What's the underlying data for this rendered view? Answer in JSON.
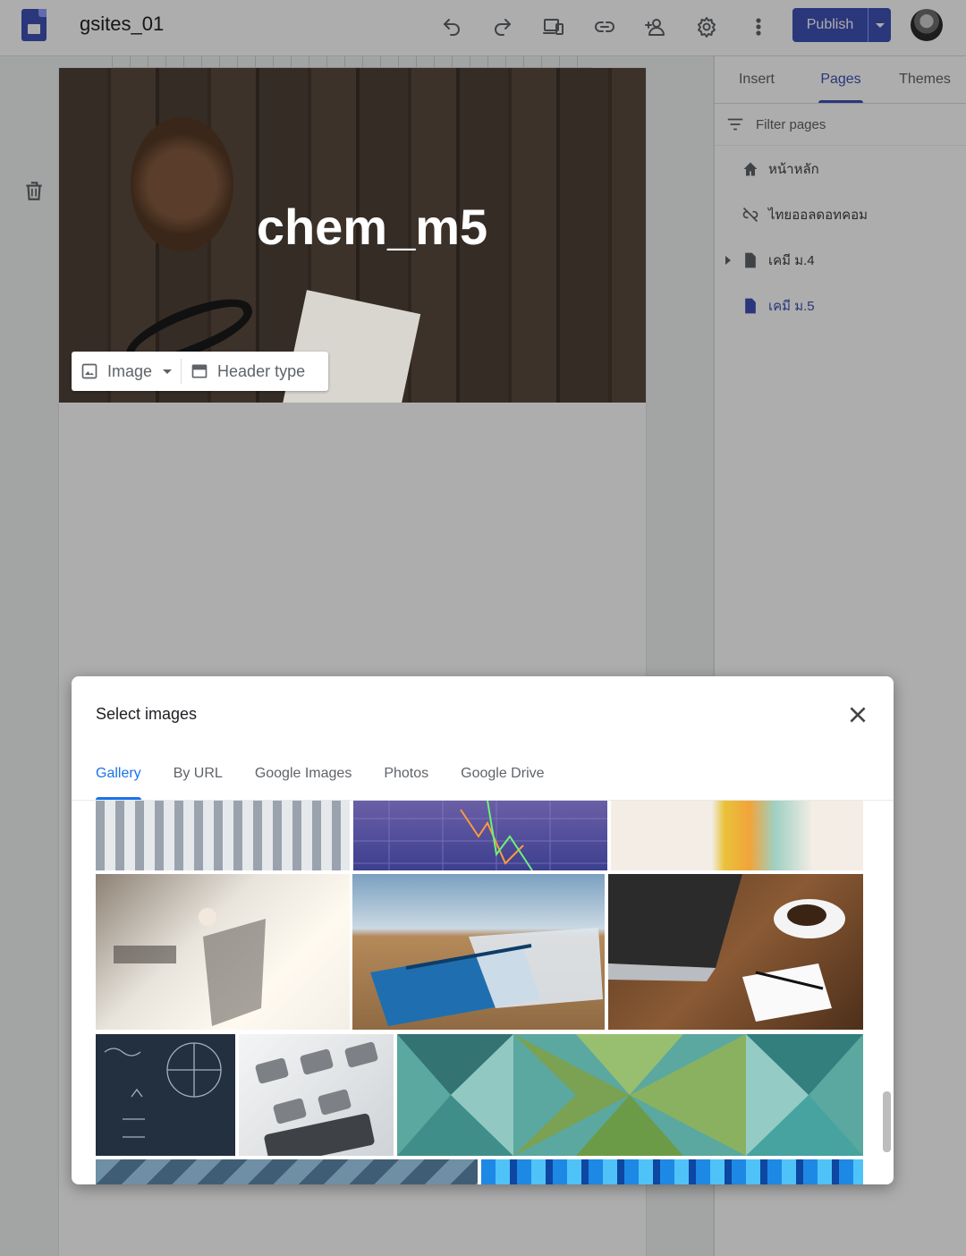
{
  "app": {
    "doc_title": "gsites_01",
    "publish_label": "Publish"
  },
  "toolbar": {
    "icons": [
      "undo-icon",
      "redo-icon",
      "preview-devices-icon",
      "link-icon",
      "share-add-person-icon",
      "settings-gear-icon",
      "more-vert-icon"
    ]
  },
  "hero": {
    "title": "chem_m5",
    "image_button": "Image",
    "header_type_button": "Header type"
  },
  "sidebar": {
    "tabs": [
      "Insert",
      "Pages",
      "Themes"
    ],
    "active_tab": "Pages",
    "filter_placeholder": "Filter pages",
    "pages": [
      {
        "label": "หน้าหลัก",
        "icon": "home-icon"
      },
      {
        "label": "ไทยออลดอทคอม",
        "icon": "hidden-link-icon"
      },
      {
        "label": "เคมี ม.4",
        "icon": "page-icon",
        "expandable": true
      },
      {
        "label": "เคมี ม.5",
        "icon": "page-icon",
        "active": true
      }
    ]
  },
  "dialog": {
    "title": "Select images",
    "tabs": [
      "Gallery",
      "By URL",
      "Google Images",
      "Photos",
      "Google Drive"
    ],
    "active_tab": "Gallery"
  },
  "colors": {
    "brand": "#3f51b5",
    "dialog_accent": "#1a73e8"
  }
}
